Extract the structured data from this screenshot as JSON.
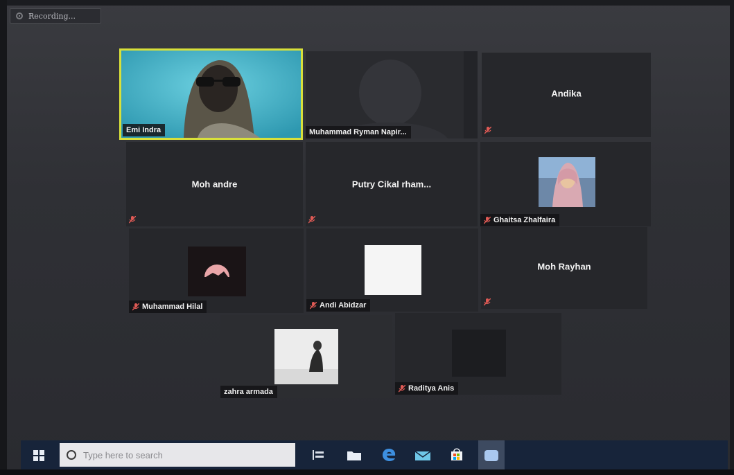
{
  "recording": {
    "label": "Recording..."
  },
  "participants": [
    {
      "name": "Emi Indra"
    },
    {
      "name": "Muhammad Ryman Napir..."
    },
    {
      "name": "Andika"
    },
    {
      "name": "Moh andre"
    },
    {
      "name": "Putry Cikal rham..."
    },
    {
      "name": "Ghaitsa Zhalfaira"
    },
    {
      "name": "Muhammad Hilal"
    },
    {
      "name": "Andi Abidzar"
    },
    {
      "name": "Moh Rayhan"
    },
    {
      "name": "zahra armada"
    },
    {
      "name": "Raditya Anis"
    }
  ],
  "taskbar": {
    "search_placeholder": "Type here to search"
  },
  "colors": {
    "active_speaker_border": "#d8e03a",
    "mute_icon": "#e05a55",
    "taskbar": "#17243a"
  }
}
